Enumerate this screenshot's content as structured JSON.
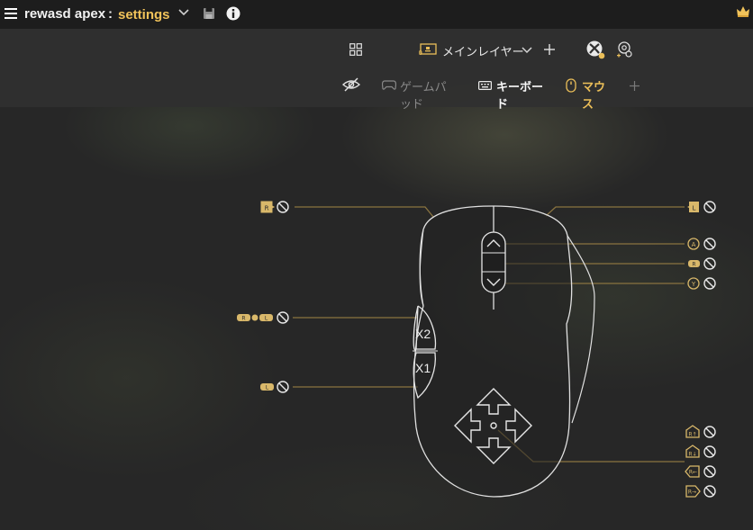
{
  "app": {
    "name": "rewasd apex",
    "colon": ":",
    "profile": "settings",
    "colors": {
      "accent": "#f1c35a",
      "line": "#8a7440",
      "text": "#ffffff",
      "muted": "#8c8c8c"
    }
  },
  "toolbar": {
    "layer_name": "メインレイヤー",
    "tabs": [
      {
        "label": "ゲームパッド",
        "icon": "gamepad-icon",
        "active": false
      },
      {
        "label": "キーボード",
        "icon": "keyboard-icon",
        "active": false
      },
      {
        "label": "マウス",
        "icon": "mouse-icon",
        "active": true
      }
    ]
  },
  "mouse": {
    "side_button_top": "X2",
    "side_button_bottom": "X1"
  },
  "mappings": {
    "left": [
      {
        "id": "left-click",
        "badge": "R"
      },
      {
        "id": "side-x2",
        "badge_a": "R",
        "badge_b": "L"
      },
      {
        "id": "side-x1",
        "badge": "L"
      }
    ],
    "right": [
      {
        "id": "right-click",
        "badge": "L"
      },
      {
        "id": "wheel-up",
        "badge": "A"
      },
      {
        "id": "wheel-click",
        "badge": "R"
      },
      {
        "id": "wheel-down",
        "badge": "Y"
      },
      {
        "id": "move-up",
        "badge": "R↑"
      },
      {
        "id": "move-down",
        "badge": "R↓"
      },
      {
        "id": "move-left",
        "badge": "R←"
      },
      {
        "id": "move-right",
        "badge": "R→"
      }
    ]
  }
}
